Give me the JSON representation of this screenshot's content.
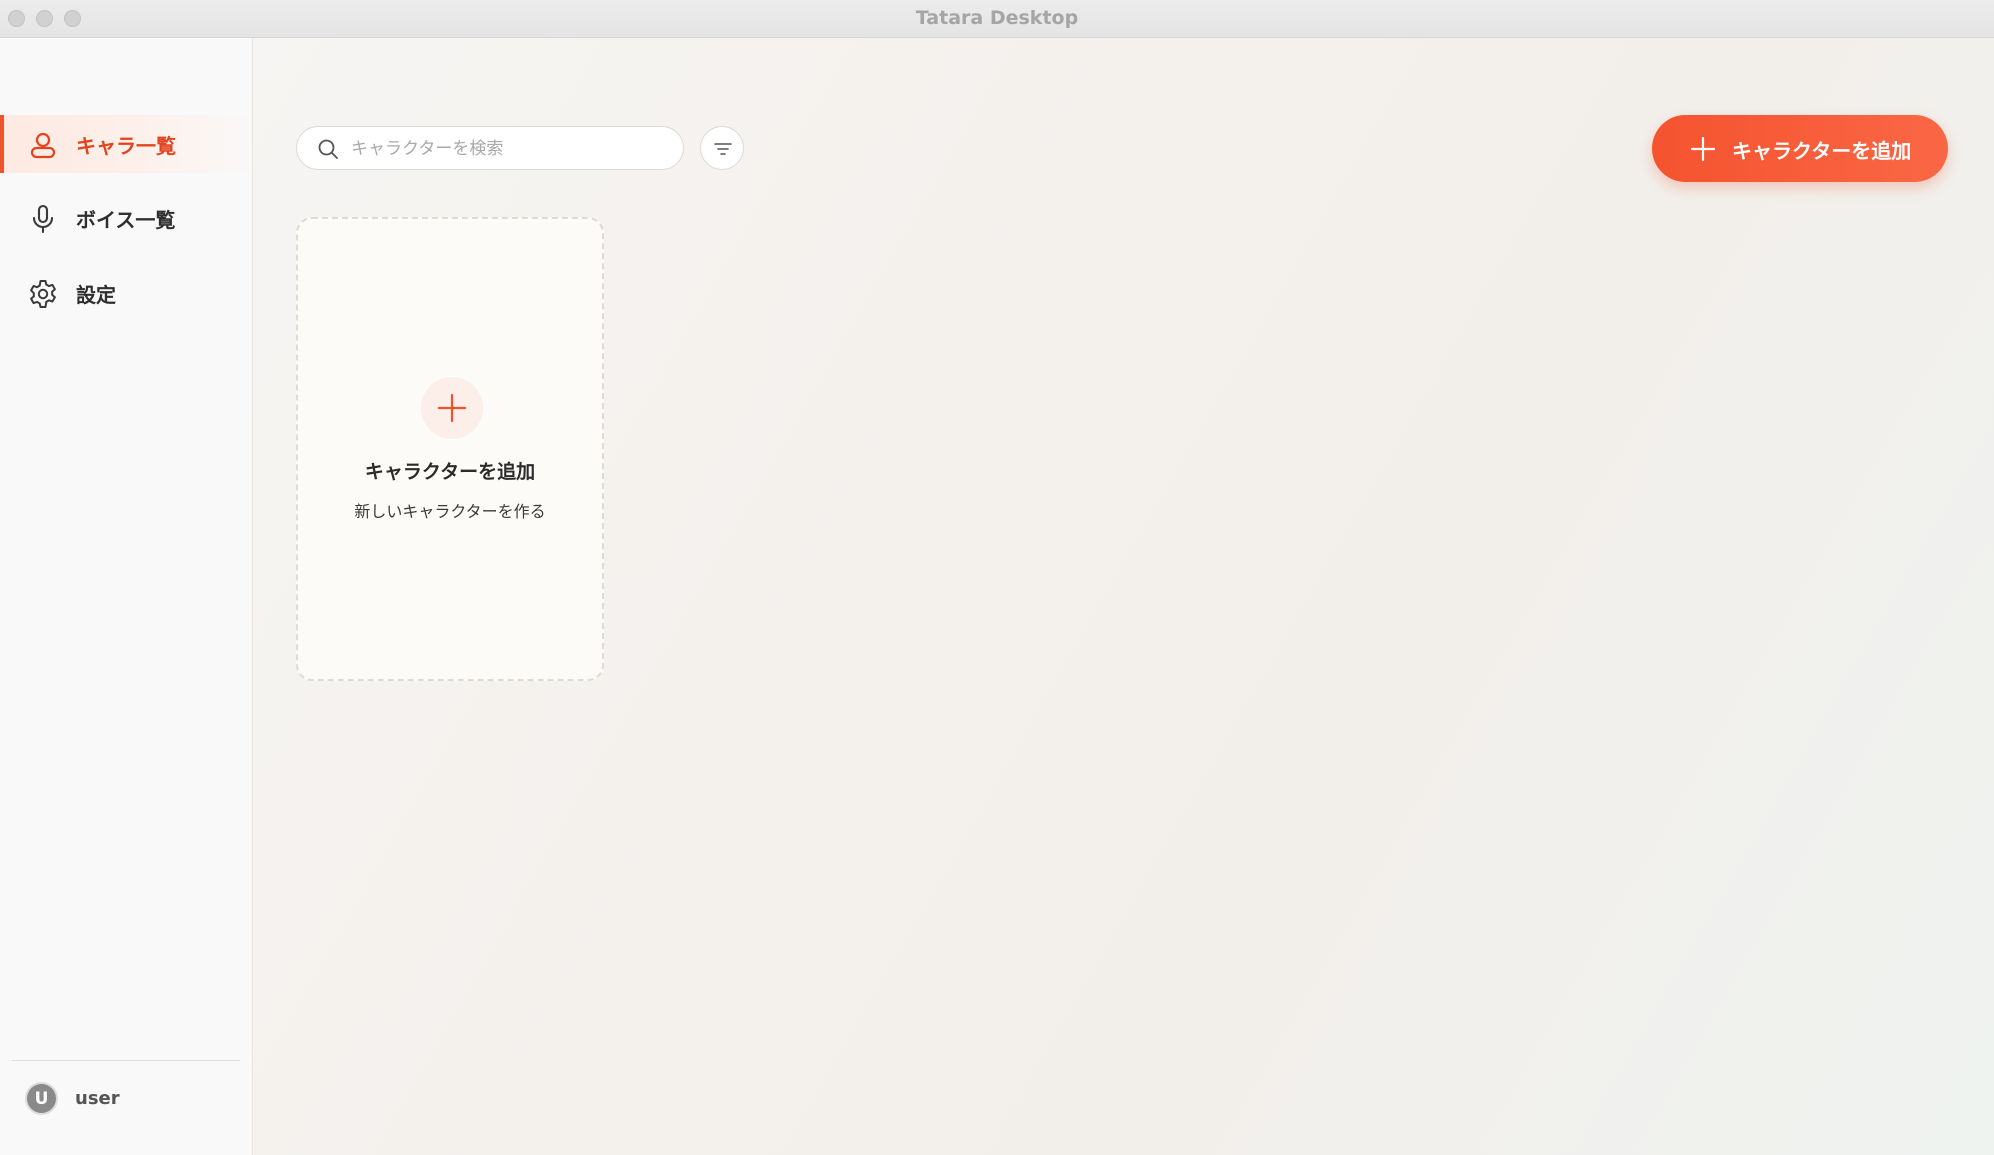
{
  "window": {
    "title": "Tatara Desktop"
  },
  "sidebar": {
    "items": [
      {
        "label": "キャラ一覧",
        "icon": "user-icon",
        "active": true
      },
      {
        "label": "ボイス一覧",
        "icon": "microphone-icon",
        "active": false
      },
      {
        "label": "設定",
        "icon": "gear-icon",
        "active": false
      }
    ],
    "user": {
      "avatar_letter": "U",
      "name": "user"
    }
  },
  "main": {
    "search": {
      "placeholder": "キャラクターを検索",
      "value": ""
    },
    "filter_icon": "filter-icon",
    "add_button": {
      "label": "キャラクターを追加",
      "icon": "plus-icon"
    },
    "add_card": {
      "title": "キャラクターを追加",
      "subtitle": "新しいキャラクターを作る",
      "icon": "plus-icon"
    }
  },
  "colors": {
    "accent": "#f2532f",
    "active_text": "#e4431f"
  }
}
